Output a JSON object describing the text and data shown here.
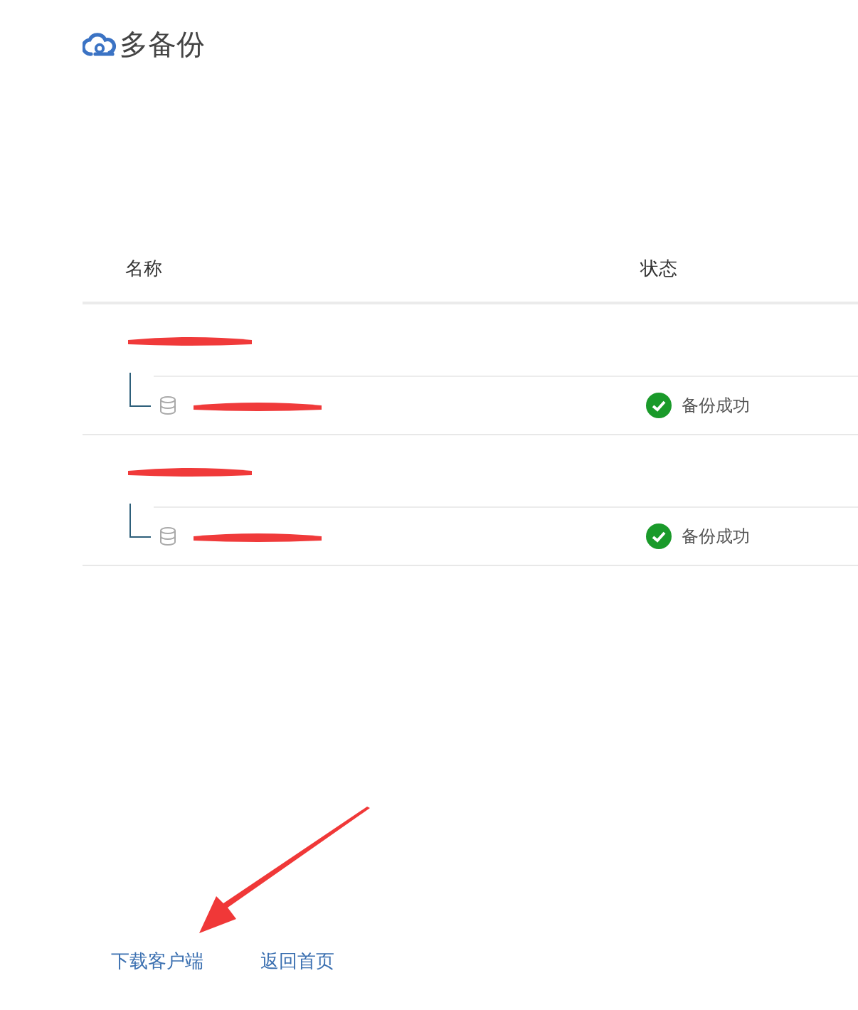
{
  "logo": {
    "text": "多备份"
  },
  "table": {
    "columns": [
      "名称",
      "状态"
    ],
    "groups": [
      {
        "redacted": true,
        "children": [
          {
            "redacted": true,
            "status": {
              "kind": "success",
              "text": "备份成功"
            }
          }
        ]
      },
      {
        "redacted": true,
        "children": [
          {
            "redacted": true,
            "status": {
              "kind": "success",
              "text": "备份成功"
            }
          }
        ]
      }
    ]
  },
  "footer_links": [
    "下载客户端",
    "返回首页"
  ]
}
